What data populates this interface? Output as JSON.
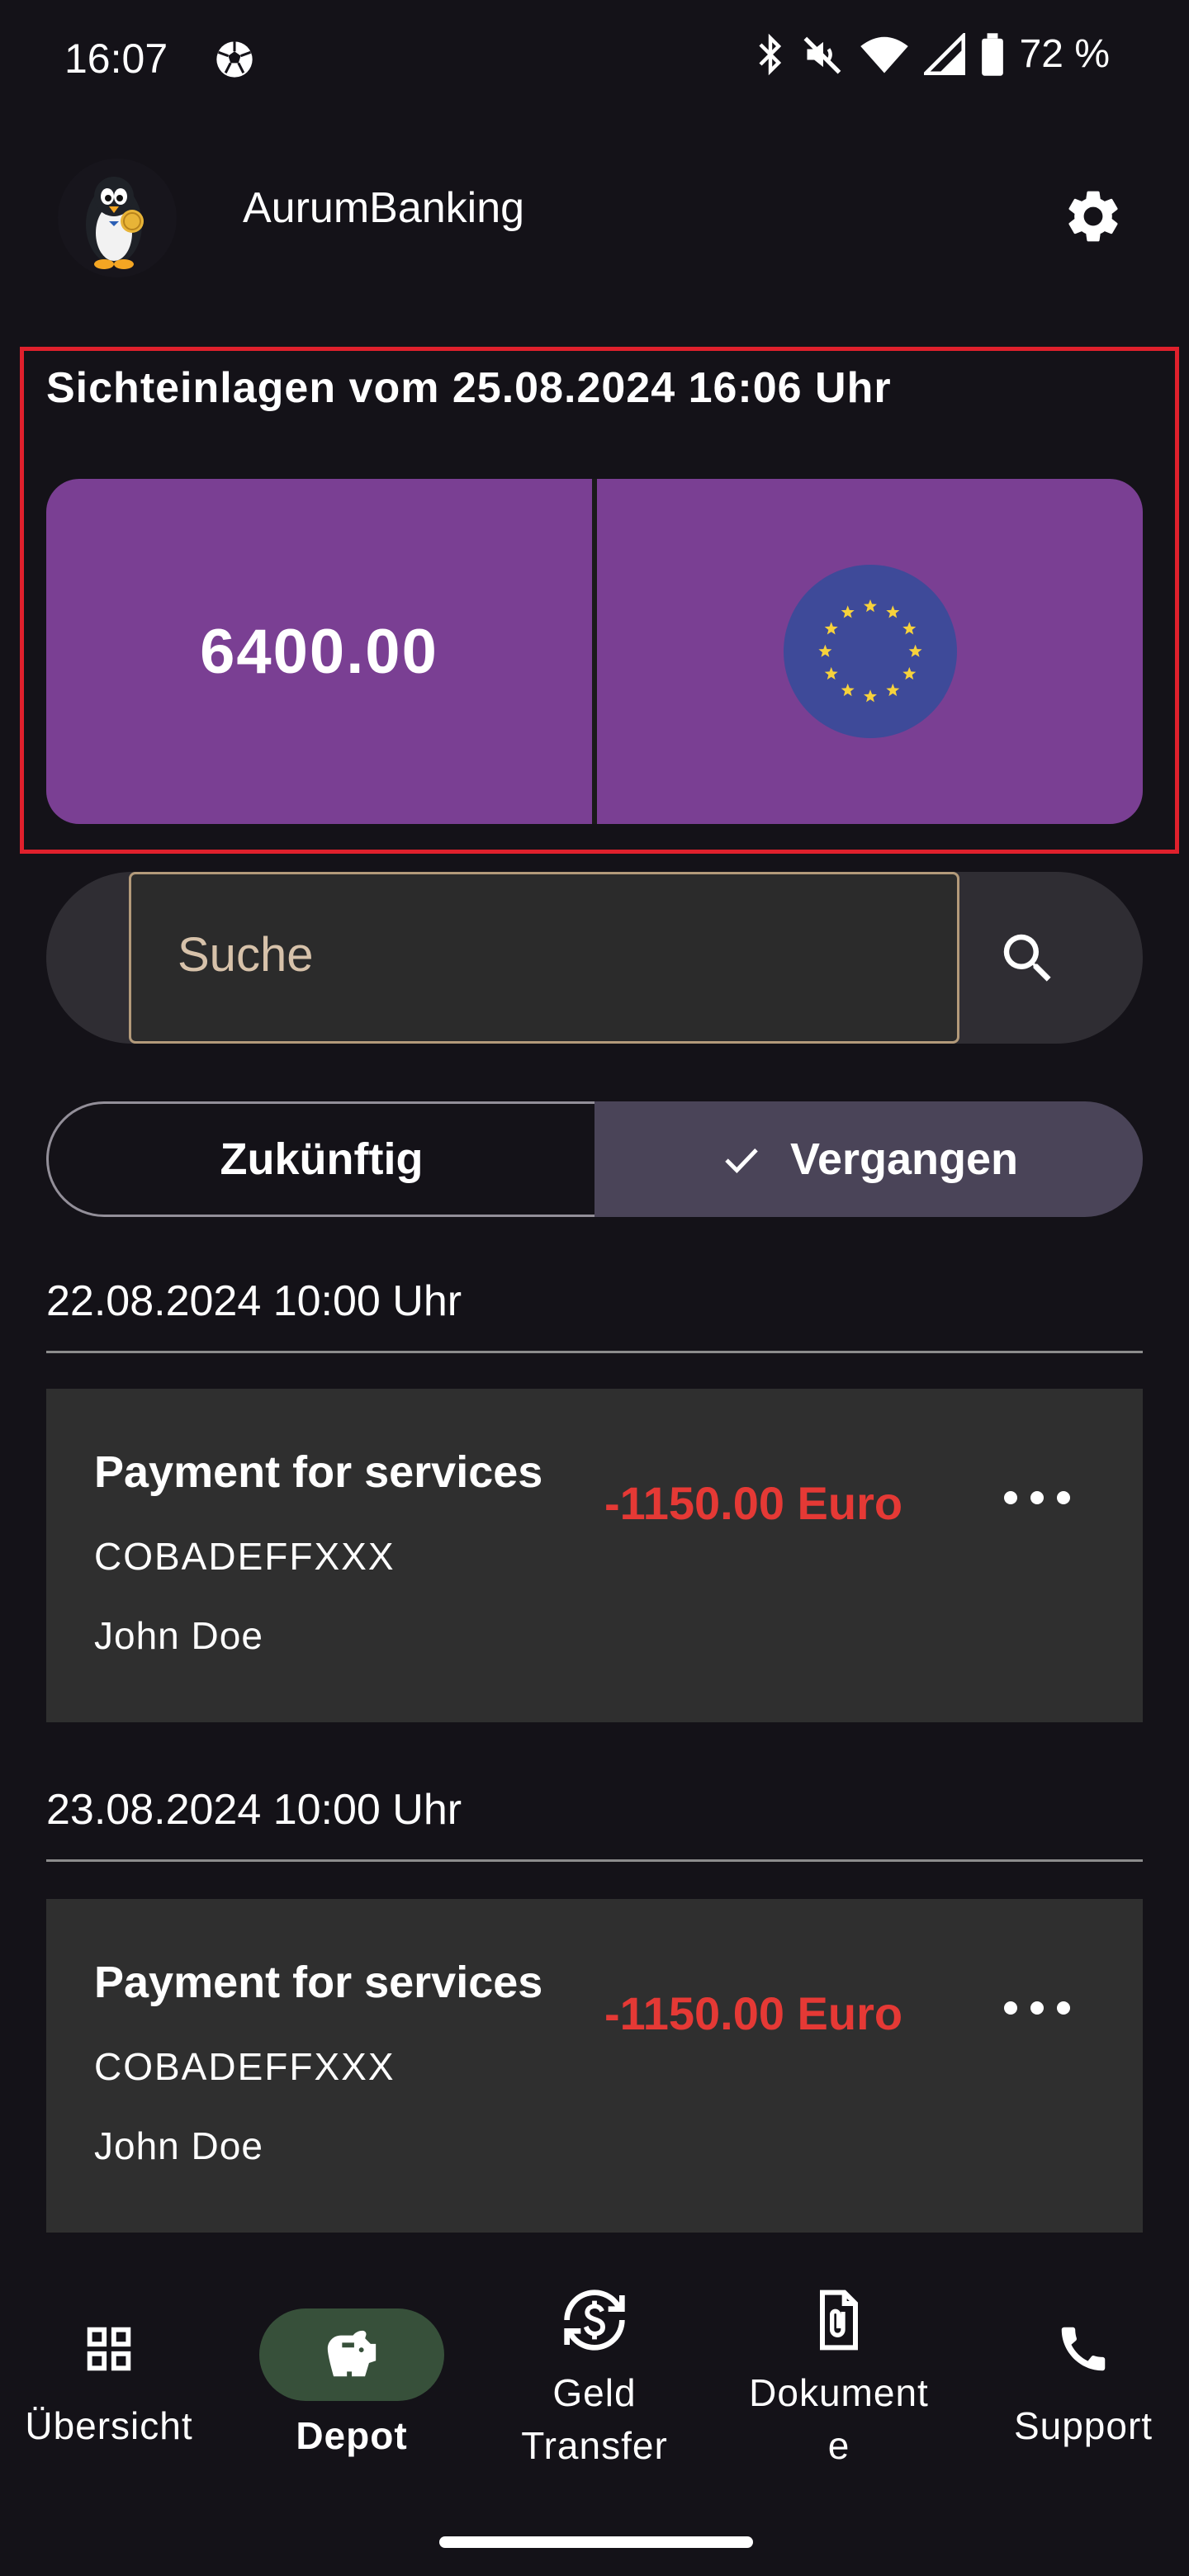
{
  "status_bar": {
    "time": "16:07",
    "battery": "72 %",
    "icons": [
      "soccer-ball-icon",
      "bluetooth-icon",
      "mute-icon",
      "wifi-icon",
      "signal-icon",
      "battery-icon"
    ]
  },
  "header": {
    "app_title": "AurumBanking",
    "logo_icon": "penguin-logo-icon",
    "settings_icon": "gear-icon"
  },
  "balance": {
    "title": "Sichteinlagen vom 25.08.2024 16:06 Uhr",
    "amount": "6400.00",
    "currency_icon": "eu-flag-icon"
  },
  "search": {
    "placeholder": "Suche",
    "icon": "search-icon"
  },
  "segments": {
    "future_label": "Zukünftig",
    "past_label": "Vergangen",
    "selected": "Vergangen"
  },
  "transactions": [
    {
      "date": "22.08.2024 10:00 Uhr",
      "title": "Payment for services",
      "bic": "COBADEFFXXX",
      "name": "John Doe",
      "amount": "-1150.00 Euro"
    },
    {
      "date": "23.08.2024 10:00 Uhr",
      "title": "Payment for services",
      "bic": "COBADEFFXXX",
      "name": "John Doe",
      "amount": "-1150.00 Euro"
    }
  ],
  "bottom_nav": {
    "items": [
      {
        "label": "Übersicht",
        "icon": "grid-icon"
      },
      {
        "label": "Depot",
        "icon": "piggy-bank-icon",
        "active": true
      },
      {
        "label": "Geld Transfer",
        "icon": "currency-exchange-icon"
      },
      {
        "label": "Dokumente",
        "icon": "document-attachment-icon"
      },
      {
        "label": "Support",
        "icon": "phone-icon"
      }
    ]
  },
  "colors": {
    "background": "#141218",
    "card_purple": "#7a3f93",
    "negative_amount": "#e53935",
    "highlight_border": "#e0202c",
    "active_nav_pill": "#37503a",
    "selected_segment": "#4a4458"
  }
}
